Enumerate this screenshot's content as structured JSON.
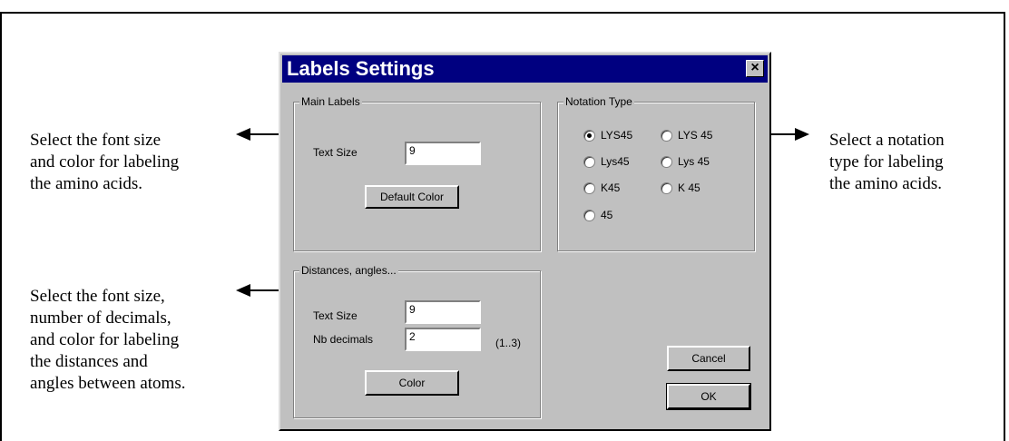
{
  "annotations": {
    "main_labels": [
      "Select the font size",
      "and color for labeling",
      "the amino acids."
    ],
    "notation": [
      "Select a notation",
      "type for labeling",
      "the amino acids."
    ],
    "distances": [
      "Select the font size,",
      "number of decimals,",
      "and color for labeling",
      "the distances and",
      "angles between atoms."
    ]
  },
  "dialog": {
    "title": "Labels Settings",
    "close_glyph": "×",
    "main_labels": {
      "legend": "Main Labels",
      "text_size_label": "Text Size",
      "text_size_value": "9",
      "default_color_button": "Default Color"
    },
    "notation_type": {
      "legend": "Notation Type",
      "selected": "LYS45",
      "options": [
        "LYS45",
        "LYS 45",
        "Lys45",
        "Lys 45",
        "K45",
        "K 45",
        "45"
      ]
    },
    "distances": {
      "legend": "Distances, angles...",
      "text_size_label": "Text Size",
      "text_size_value": "9",
      "decimals_label": "Nb decimals",
      "decimals_value": "2",
      "decimals_range": "(1..3)",
      "color_button": "Color"
    },
    "cancel_button": "Cancel",
    "ok_button": "OK"
  }
}
